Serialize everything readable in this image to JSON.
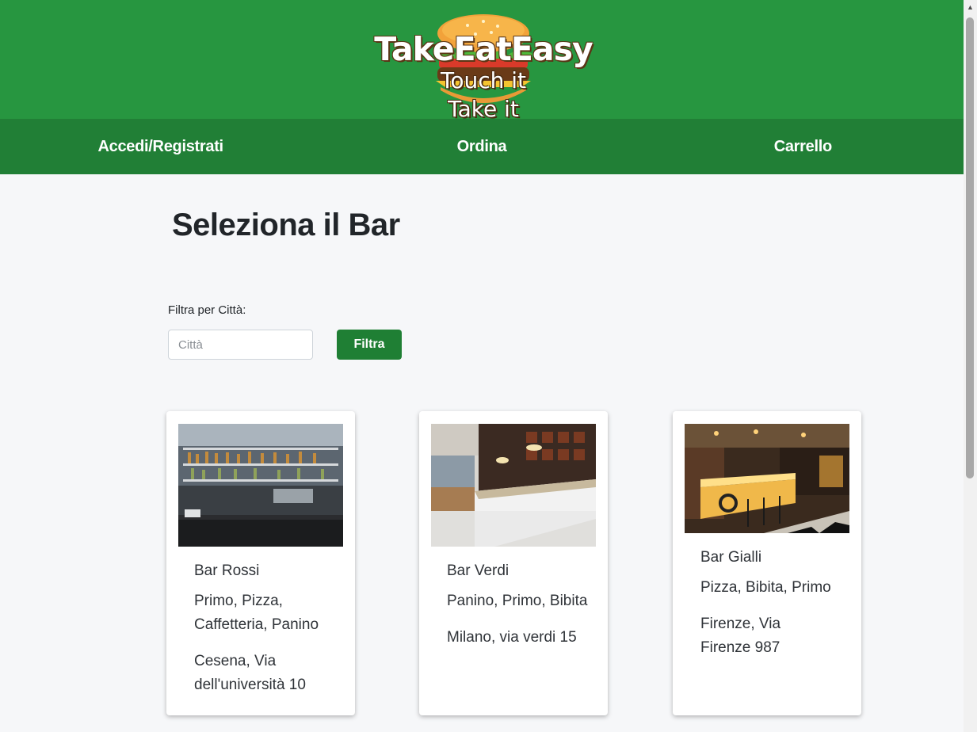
{
  "brand": {
    "title": "TakeEatEasy",
    "tagline_1": "Touch it",
    "tagline_2": "Take it",
    "logo_icon": "burger-icon",
    "header_color": "#279640",
    "nav_color": "#217f36"
  },
  "nav": {
    "items": [
      {
        "label": "Accedi/Registrati"
      },
      {
        "label": "Ordina"
      },
      {
        "label": "Carrello"
      }
    ]
  },
  "main": {
    "title": "Seleziona il Bar",
    "filter": {
      "label": "Filtra per Città:",
      "placeholder": "Città",
      "value": "",
      "button_label": "Filtra"
    }
  },
  "bars": [
    {
      "name": "Bar Rossi",
      "categories": "Primo, Pizza, Caffetteria, Panino",
      "address": "Cesena, Via dell'università 10"
    },
    {
      "name": "Bar Verdi",
      "categories": "Panino, Primo, Bibita",
      "address": "Milano, via verdi 15"
    },
    {
      "name": "Bar Gialli",
      "categories": "Pizza, Bibita, Primo",
      "address": "Firenze, Via Firenze 987"
    }
  ]
}
